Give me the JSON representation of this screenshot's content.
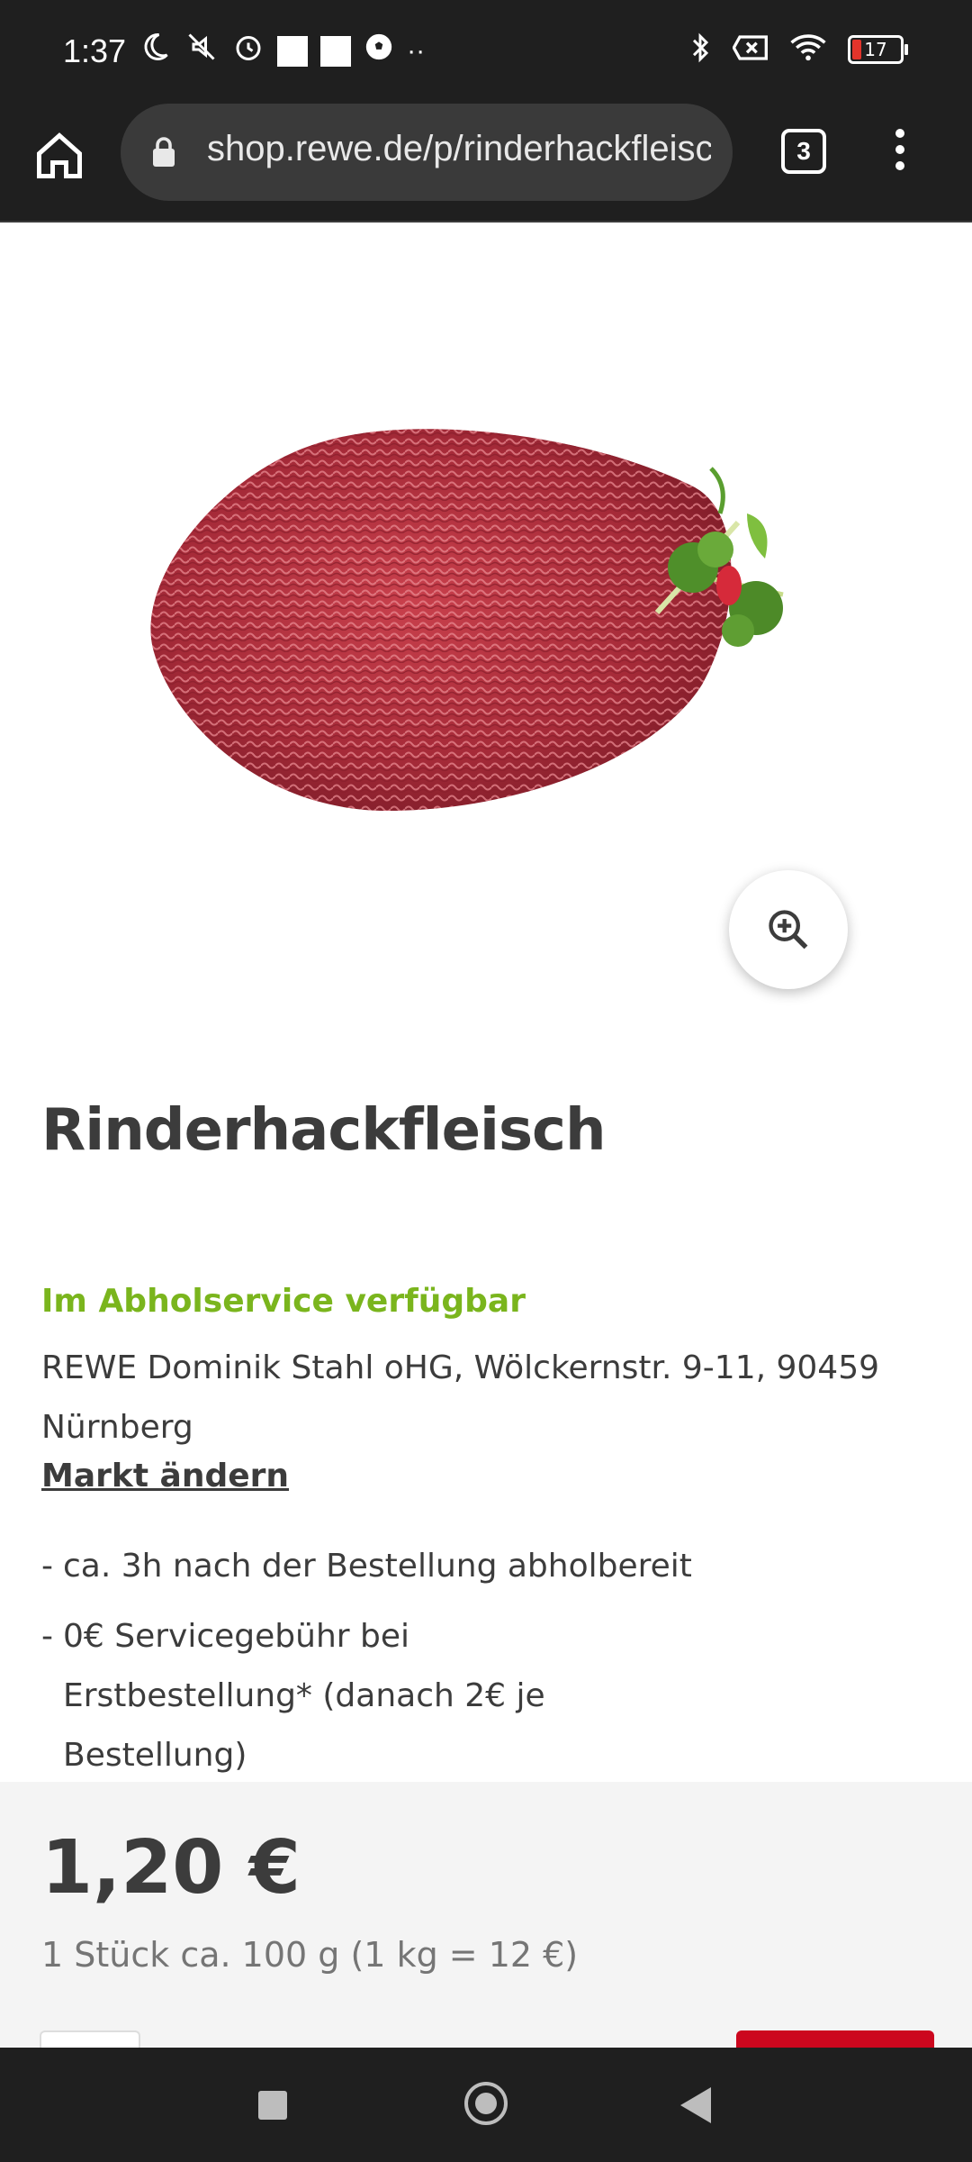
{
  "status_bar": {
    "time": "1:37",
    "battery": "17",
    "icons": [
      "moon-icon",
      "mute-icon",
      "alarm-icon",
      "square-notification-icon",
      "square-notification-icon",
      "soccer-icon",
      "more-dots-icon",
      "bluetooth-icon",
      "data-off-icon",
      "wifi-icon",
      "battery-icon"
    ]
  },
  "browser": {
    "url": "shop.rewe.de/p/rinderhackfleisch",
    "tab_count": "3"
  },
  "product": {
    "title": "Rinderhackfleisch",
    "image_alt": "Rinderhackfleisch",
    "availability": "Im Abholservice verfügbar",
    "store": "REWE Dominik Stahl oHG, Wölckernstr. 9-11, 90459 Nürnberg",
    "change_market": "Markt ändern",
    "bullets": [
      {
        "dash": "-",
        "text": "ca. 3h nach der Bestellung abholbereit"
      },
      {
        "dash": "-",
        "text": "0€ Servicegebühr bei Erstbestellung* (danach 2€ je Bestellung)"
      }
    ],
    "price": "1,20 €",
    "unit_info": "1 Stück ca. 100 g (1 kg = 12 €)"
  },
  "colors": {
    "accent_green": "#7ab51d",
    "rewe_red": "#cc071e",
    "dark_bar": "#1f1f1f"
  }
}
